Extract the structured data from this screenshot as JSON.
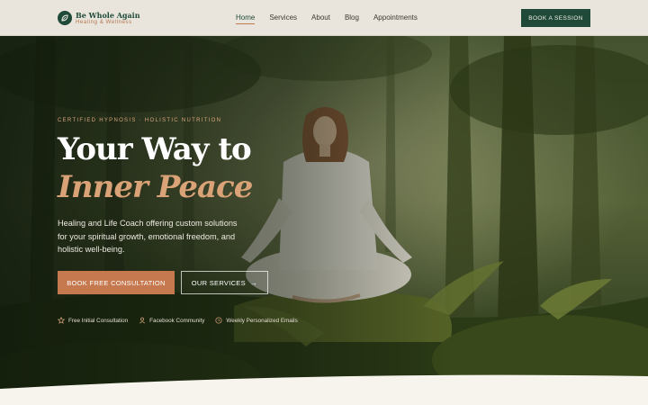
{
  "brand": {
    "name": "Be Whole Again",
    "tagline": "Healing & Wellness",
    "logo_icon": "leaf-icon",
    "color_primary": "#1f4a39",
    "color_accent": "#c6784e"
  },
  "nav": {
    "items": [
      {
        "label": "Home",
        "active": true
      },
      {
        "label": "Services",
        "active": false
      },
      {
        "label": "About",
        "active": false
      },
      {
        "label": "Blog",
        "active": false
      },
      {
        "label": "Appointments",
        "active": false
      }
    ],
    "cta_label": "BOOK A SESSION"
  },
  "hero": {
    "eyebrow": "CERTIFIED HYPNOSIS · HOLISTIC NUTRITION",
    "headline_line1": "Your Way to",
    "headline_line2": "Inner Peace",
    "description": "Healing and Life Coach offering custom solutions for your spiritual growth, emotional freedom, and holistic well-being.",
    "primary_button": "BOOK FREE CONSULTATION",
    "secondary_button": "OUR SERVICES",
    "secondary_icon": "arrow-right-icon",
    "features": [
      {
        "icon": "star-icon",
        "label": "Free Initial Consultation"
      },
      {
        "icon": "user-icon",
        "label": "Facebook Community"
      },
      {
        "icon": "clock-icon",
        "label": "Weekly Personalized Emails"
      }
    ]
  }
}
